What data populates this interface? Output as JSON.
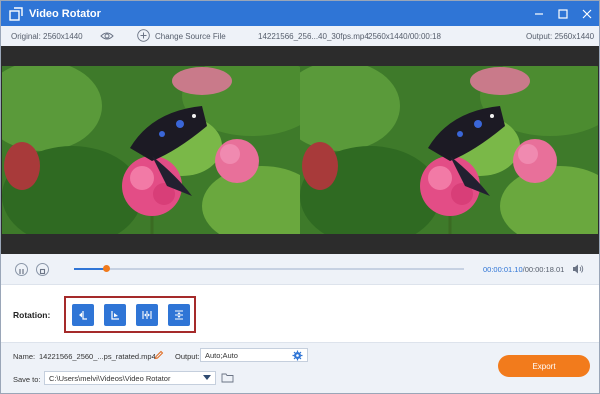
{
  "app": {
    "title": "Video Rotator"
  },
  "info": {
    "original": "Original: 2560x1440",
    "change_source": "Change Source File",
    "filename": "14221566_256...40_30fps.mp4",
    "meta": "2560x1440/00:00:18",
    "output": "Output: 2560x1440"
  },
  "playback": {
    "current_time": "00:00:01.10",
    "total_time": "/00:00:18.01",
    "progress_fraction": 0.081
  },
  "rotation": {
    "label": "Rotation:",
    "buttons": [
      "rotate-left",
      "rotate-right",
      "flip-horizontal",
      "flip-vertical"
    ]
  },
  "output_settings": {
    "name_label": "Name:",
    "name_value": "14221566_2560_...ps_ratated.mp4",
    "output_label": "Output:",
    "output_value": "Auto;Auto",
    "save_label": "Save to:",
    "save_path": "C:\\Users\\melvi\\Videos\\Video Rotator",
    "export_label": "Export"
  },
  "colors": {
    "accent": "#2f75d6",
    "export": "#f27b1c",
    "highlight_box": "#a52a2a"
  }
}
